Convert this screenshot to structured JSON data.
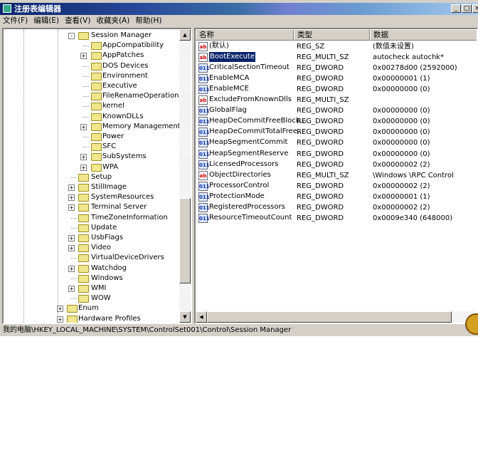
{
  "window": {
    "title": "注册表编辑器",
    "min": "_",
    "max": "□",
    "close": "×"
  },
  "menu": [
    "文件(F)",
    "编辑(E)",
    "查看(V)",
    "收藏夹(A)",
    "帮助(H)"
  ],
  "tree": [
    {
      "label": "Session Manager",
      "level": 2,
      "expander": "-",
      "open": true
    },
    {
      "label": "AppCompatibility",
      "level": 3,
      "expander": ""
    },
    {
      "label": "AppPatches",
      "level": 3,
      "expander": "+"
    },
    {
      "label": "DOS Devices",
      "level": 3,
      "expander": ""
    },
    {
      "label": "Environment",
      "level": 3,
      "expander": ""
    },
    {
      "label": "Executive",
      "level": 3,
      "expander": ""
    },
    {
      "label": "FileRenameOperations",
      "level": 3,
      "expander": ""
    },
    {
      "label": "kernel",
      "level": 3,
      "expander": ""
    },
    {
      "label": "KnownDLLs",
      "level": 3,
      "expander": ""
    },
    {
      "label": "Memory Management",
      "level": 3,
      "expander": "+"
    },
    {
      "label": "Power",
      "level": 3,
      "expander": ""
    },
    {
      "label": "SFC",
      "level": 3,
      "expander": ""
    },
    {
      "label": "SubSystems",
      "level": 3,
      "expander": "+"
    },
    {
      "label": "WPA",
      "level": 3,
      "expander": "+"
    },
    {
      "label": "Setup",
      "level": 2,
      "expander": ""
    },
    {
      "label": "StillImage",
      "level": 2,
      "expander": "+"
    },
    {
      "label": "SystemResources",
      "level": 2,
      "expander": "+"
    },
    {
      "label": "Terminal Server",
      "level": 2,
      "expander": "+"
    },
    {
      "label": "TimeZoneInformation",
      "level": 2,
      "expander": ""
    },
    {
      "label": "Update",
      "level": 2,
      "expander": ""
    },
    {
      "label": "UsbFlags",
      "level": 2,
      "expander": "+"
    },
    {
      "label": "Video",
      "level": 2,
      "expander": "+"
    },
    {
      "label": "VirtualDeviceDrivers",
      "level": 2,
      "expander": ""
    },
    {
      "label": "Watchdog",
      "level": 2,
      "expander": "+"
    },
    {
      "label": "Windows",
      "level": 2,
      "expander": ""
    },
    {
      "label": "WMI",
      "level": 2,
      "expander": "+"
    },
    {
      "label": "WOW",
      "level": 2,
      "expander": ""
    },
    {
      "label": "Enum",
      "level": 1,
      "expander": "+"
    },
    {
      "label": "Hardware Profiles",
      "level": 1,
      "expander": "+"
    }
  ],
  "list": {
    "headers": [
      "名称",
      "类型",
      "数据"
    ],
    "rows": [
      {
        "icon": "ab",
        "name": "(默认)",
        "type": "REG_SZ",
        "data": "(数值未设置)"
      },
      {
        "icon": "ab",
        "name": "BootExecute",
        "type": "REG_MULTI_SZ",
        "data": "autocheck autochk*",
        "selected": true
      },
      {
        "icon": "dw",
        "name": "CriticalSectionTimeout",
        "type": "REG_DWORD",
        "data": "0x00278d00 (2592000)"
      },
      {
        "icon": "dw",
        "name": "EnableMCA",
        "type": "REG_DWORD",
        "data": "0x00000001 (1)"
      },
      {
        "icon": "dw",
        "name": "EnableMCE",
        "type": "REG_DWORD",
        "data": "0x00000000 (0)"
      },
      {
        "icon": "ab",
        "name": "ExcludeFromKnownDlls",
        "type": "REG_MULTI_SZ",
        "data": ""
      },
      {
        "icon": "dw",
        "name": "GlobalFlag",
        "type": "REG_DWORD",
        "data": "0x00000000 (0)"
      },
      {
        "icon": "dw",
        "name": "HeapDeCommitFreeBlock...",
        "type": "REG_DWORD",
        "data": "0x00000000 (0)"
      },
      {
        "icon": "dw",
        "name": "HeapDeCommitTotalFree...",
        "type": "REG_DWORD",
        "data": "0x00000000 (0)"
      },
      {
        "icon": "dw",
        "name": "HeapSegmentCommit",
        "type": "REG_DWORD",
        "data": "0x00000000 (0)"
      },
      {
        "icon": "dw",
        "name": "HeapSegmentReserve",
        "type": "REG_DWORD",
        "data": "0x00000000 (0)"
      },
      {
        "icon": "dw",
        "name": "LicensedProcessors",
        "type": "REG_DWORD",
        "data": "0x00000002 (2)"
      },
      {
        "icon": "ab",
        "name": "ObjectDirectories",
        "type": "REG_MULTI_SZ",
        "data": "\\Windows \\RPC Control"
      },
      {
        "icon": "dw",
        "name": "ProcessorControl",
        "type": "REG_DWORD",
        "data": "0x00000002 (2)"
      },
      {
        "icon": "dw",
        "name": "ProtectionMode",
        "type": "REG_DWORD",
        "data": "0x00000001 (1)"
      },
      {
        "icon": "dw",
        "name": "RegisteredProcessors",
        "type": "REG_DWORD",
        "data": "0x00000002 (2)"
      },
      {
        "icon": "dw",
        "name": "ResourceTimeoutCount",
        "type": "REG_DWORD",
        "data": "0x0009e340 (648000)"
      }
    ]
  },
  "icon_labels": {
    "ab": "ab",
    "dw": "011"
  },
  "status": "我的电脑\\HKEY_LOCAL_MACHINE\\SYSTEM\\ControlSet001\\Control\\Session Manager"
}
